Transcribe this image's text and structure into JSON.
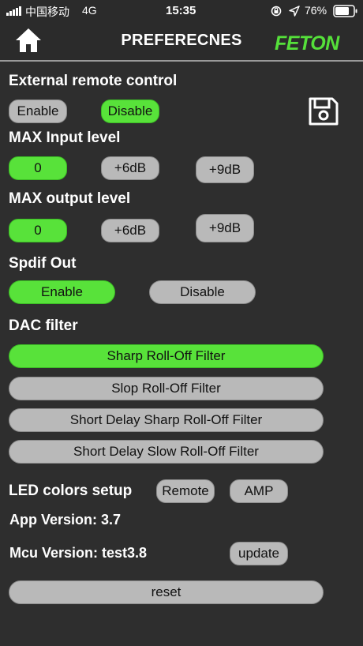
{
  "status_bar": {
    "carrier": "中国移动",
    "network": "4G",
    "time": "15:35",
    "battery": "76%"
  },
  "header": {
    "title": "PREFERECNES",
    "logo": "FETON"
  },
  "external_remote": {
    "label": "External remote control",
    "enable": "Enable",
    "disable": "Disable",
    "selected": "Disable"
  },
  "max_input": {
    "label": "MAX Input level",
    "options": [
      "0",
      "+6dB",
      "+9dB"
    ],
    "selected": "0"
  },
  "max_output": {
    "label": "MAX output level",
    "options": [
      "0",
      "+6dB",
      "+9dB"
    ],
    "selected": "0"
  },
  "spdif": {
    "label": "Spdif Out",
    "enable": "Enable",
    "disable": "Disable",
    "selected": "Enable"
  },
  "dac_filter": {
    "label": "DAC filter",
    "options": [
      "Sharp Roll-Off Filter",
      "Slop Roll-Off Filter",
      "Short Delay Sharp Roll-Off Filter",
      "Short Delay Slow Roll-Off Filter"
    ],
    "selected": "Sharp Roll-Off Filter"
  },
  "led": {
    "label": "LED colors setup",
    "remote": "Remote",
    "amp": "AMP"
  },
  "app_version": "App Version: 3.7",
  "mcu": {
    "label": "Mcu Version: test3.8",
    "update": "update"
  },
  "reset": "reset",
  "colors": {
    "selected": "#58e23a",
    "unselected": "#b9b9b9",
    "background": "#2e2e2e",
    "logo": "#55e03a"
  },
  "icons": [
    "home-icon",
    "save-icon",
    "signal-icon",
    "lock-rotation-icon",
    "location-arrow-icon",
    "battery-icon"
  ]
}
